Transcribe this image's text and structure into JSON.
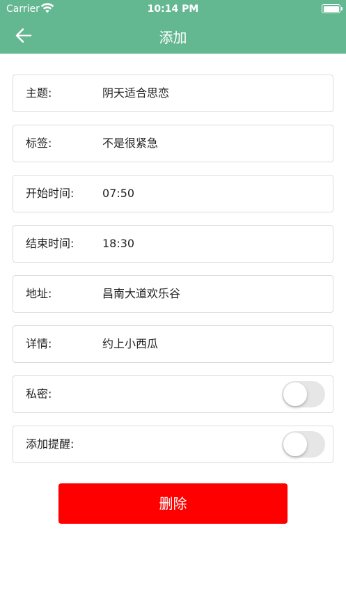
{
  "status_bar": {
    "carrier": "Carrier",
    "time": "10:14 PM"
  },
  "nav": {
    "title": "添加",
    "back_icon": "arrow-left-icon"
  },
  "colors": {
    "header_bg": "#64b891",
    "delete_bg": "#ff0000"
  },
  "form": {
    "subject": {
      "label": "主题:",
      "value": "阴天适合思恋"
    },
    "tag": {
      "label": "标签:",
      "value": "不是很紧急"
    },
    "start_time": {
      "label": "开始时间:",
      "value": "07:50"
    },
    "end_time": {
      "label": "结束时间:",
      "value": "18:30"
    },
    "address": {
      "label": "地址:",
      "value": "昌南大道欢乐谷"
    },
    "details": {
      "label": "详情:",
      "value": "约上小西瓜"
    },
    "private": {
      "label": "私密:",
      "on": false
    },
    "reminder": {
      "label": "添加提醒:",
      "on": false
    }
  },
  "delete_label": "删除"
}
